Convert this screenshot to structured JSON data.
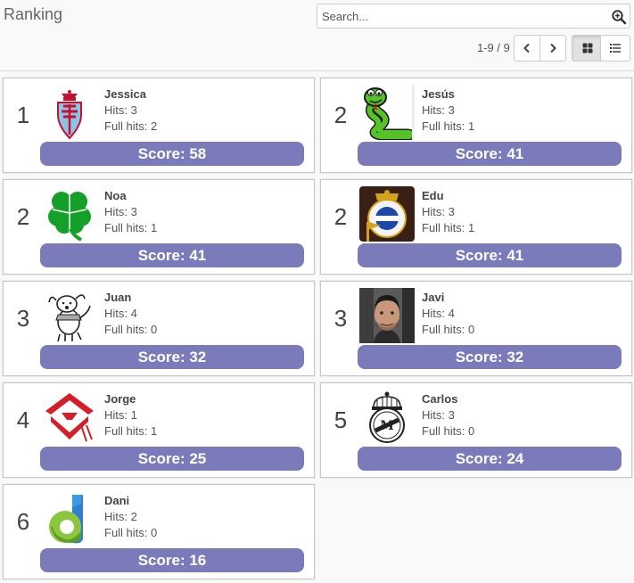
{
  "header": {
    "title": "Ranking",
    "search": {
      "placeholder": "Search...",
      "value": ""
    },
    "pager": {
      "text": "1-9 / 9"
    }
  },
  "colors": {
    "score_bar": "#7b7bbb",
    "card_border": "#c8c8c8"
  },
  "players": [
    {
      "rank": "1",
      "name": "Jessica",
      "hits": "Hits: 3",
      "full_hits": "Full hits: 2",
      "score": "Score: 58",
      "avatar": "celta-crest-icon"
    },
    {
      "rank": "2",
      "name": "Jesús",
      "hits": "Hits: 3",
      "full_hits": "Full hits: 1",
      "score": "Score: 41",
      "avatar": "snake-icon"
    },
    {
      "rank": "2",
      "name": "Noa",
      "hits": "Hits: 3",
      "full_hits": "Full hits: 1",
      "score": "Score: 41",
      "avatar": "clover-icon"
    },
    {
      "rank": "2",
      "name": "Edu",
      "hits": "Hits: 3",
      "full_hits": "Full hits: 1",
      "score": "Score: 41",
      "avatar": "deportivo-crest-icon"
    },
    {
      "rank": "3",
      "name": "Juan",
      "hits": "Hits: 4",
      "full_hits": "Full hits: 0",
      "score": "Score: 32",
      "avatar": "dog-icon"
    },
    {
      "rank": "3",
      "name": "Javi",
      "hits": "Hits: 4",
      "full_hits": "Full hits: 0",
      "score": "Score: 32",
      "avatar": "person-photo-icon"
    },
    {
      "rank": "4",
      "name": "Jorge",
      "hits": "Hits: 1",
      "full_hits": "Full hits: 1",
      "score": "Score: 25",
      "avatar": "red-logo-icon"
    },
    {
      "rank": "5",
      "name": "Carlos",
      "hits": "Hits: 3",
      "full_hits": "Full hits: 0",
      "score": "Score: 24",
      "avatar": "real-madrid-crest-icon"
    },
    {
      "rank": "6",
      "name": "Dani",
      "hits": "Hits: 2",
      "full_hits": "Full hits: 0",
      "score": "Score: 16",
      "avatar": "letter-d-logo-icon"
    }
  ]
}
